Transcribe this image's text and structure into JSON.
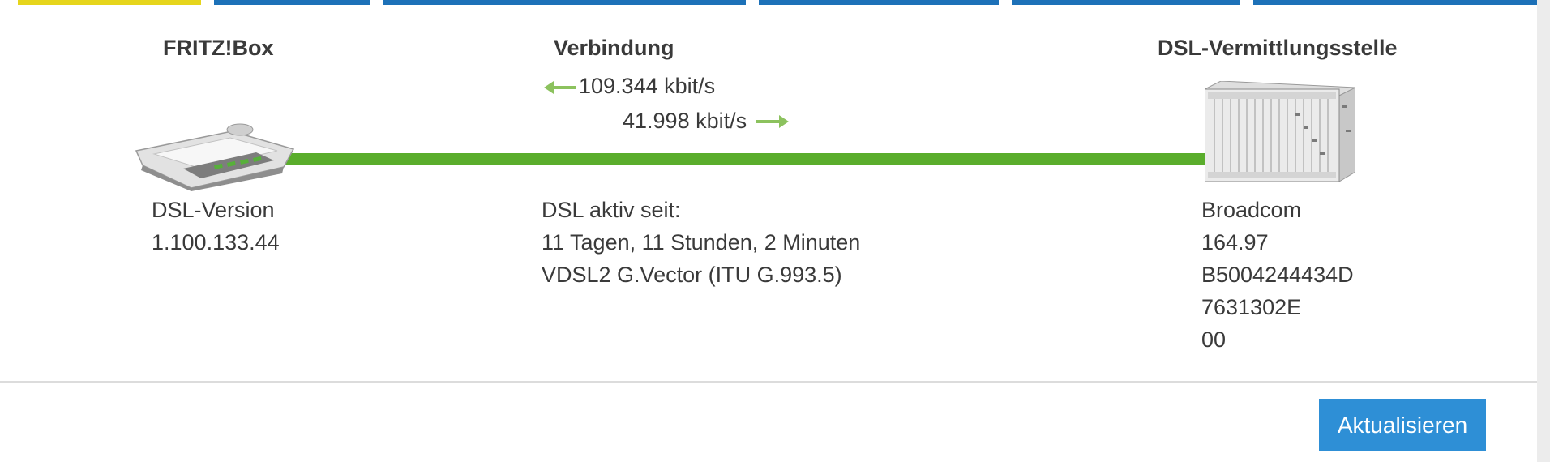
{
  "colors": {
    "tab_blue": "#1d71b8",
    "tab_active": "#e6d51c",
    "line_green": "#5aad2c",
    "button_blue": "#2e8fd6"
  },
  "headers": {
    "device": "FRITZ!Box",
    "connection": "Verbindung",
    "exchange": "DSL-Vermittlungsstelle"
  },
  "rates": {
    "downstream": "109.344 kbit/s",
    "upstream": "41.998 kbit/s"
  },
  "device": {
    "label": "DSL-Version",
    "value": "1.100.133.44"
  },
  "connection": {
    "label": "DSL aktiv seit:",
    "duration": "11 Tagen, 11 Stunden, 2 Minuten",
    "standard": "VDSL2 G.Vector (ITU G.993.5)"
  },
  "exchange": {
    "lines": [
      "Broadcom",
      "164.97",
      "B5004244434D",
      "7631302E",
      "00"
    ]
  },
  "buttons": {
    "refresh": "Aktualisieren"
  },
  "icons": {
    "router": "fritzbox-router-icon",
    "exchange": "dslam-rack-icon",
    "left_arrow": "arrow-left-icon",
    "right_arrow": "arrow-right-icon"
  }
}
